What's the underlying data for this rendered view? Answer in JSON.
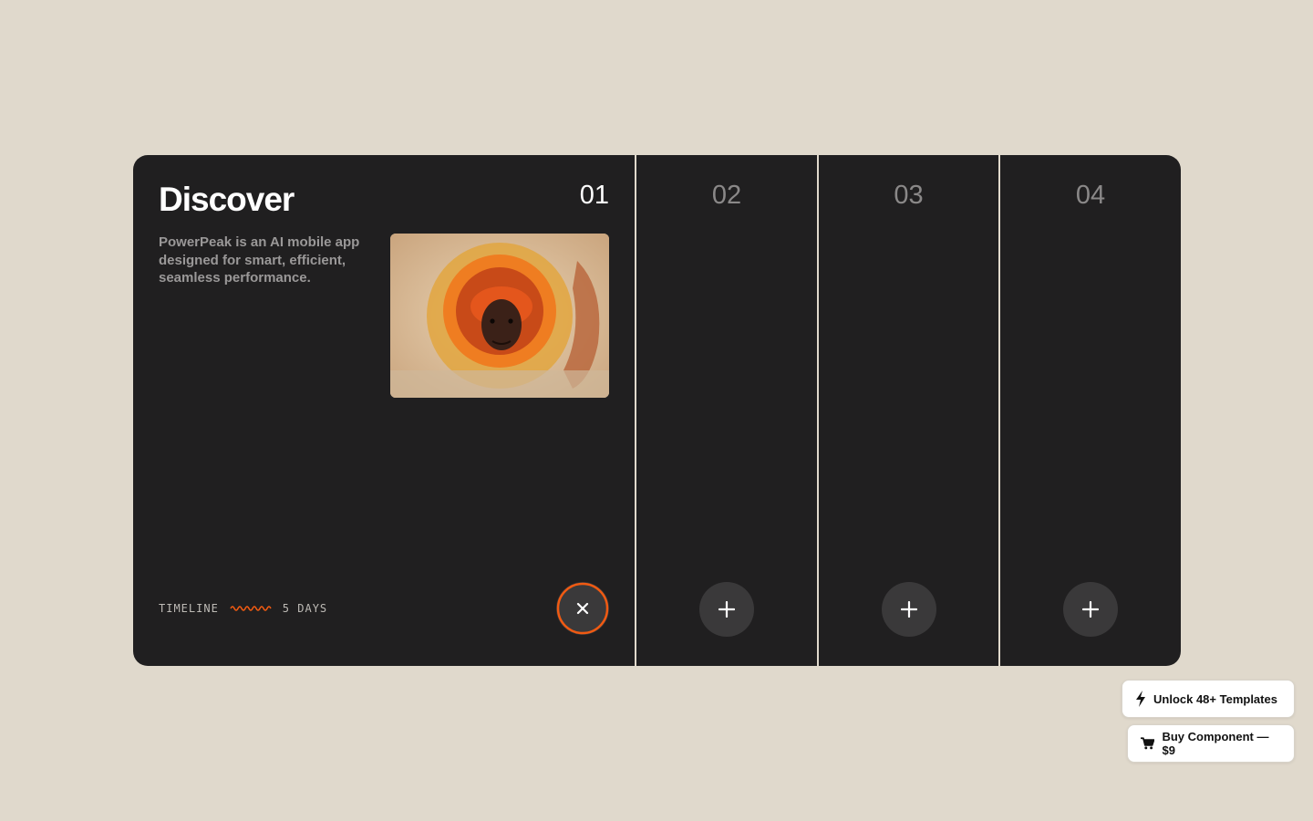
{
  "panels": [
    {
      "number": "01",
      "title": "Discover",
      "description": "PowerPeak is an AI mobile app designed for smart, efficient, seamless performance.",
      "timeline_label": "TIMELINE",
      "timeline_value": "5 DAYS",
      "action_icon": "close-icon",
      "active": true
    },
    {
      "number": "02",
      "action_icon": "plus-icon",
      "active": false
    },
    {
      "number": "03",
      "action_icon": "plus-icon",
      "active": false
    },
    {
      "number": "04",
      "action_icon": "plus-icon",
      "active": false
    }
  ],
  "promo": {
    "unlock_label": "Unlock 48+ Templates",
    "unlock_icon": "lightning-icon",
    "buy_label": "Buy Component — $9",
    "buy_icon": "cart-icon"
  },
  "colors": {
    "background": "#e0d9cc",
    "card": "#201f20",
    "accent": "#f05a12"
  }
}
